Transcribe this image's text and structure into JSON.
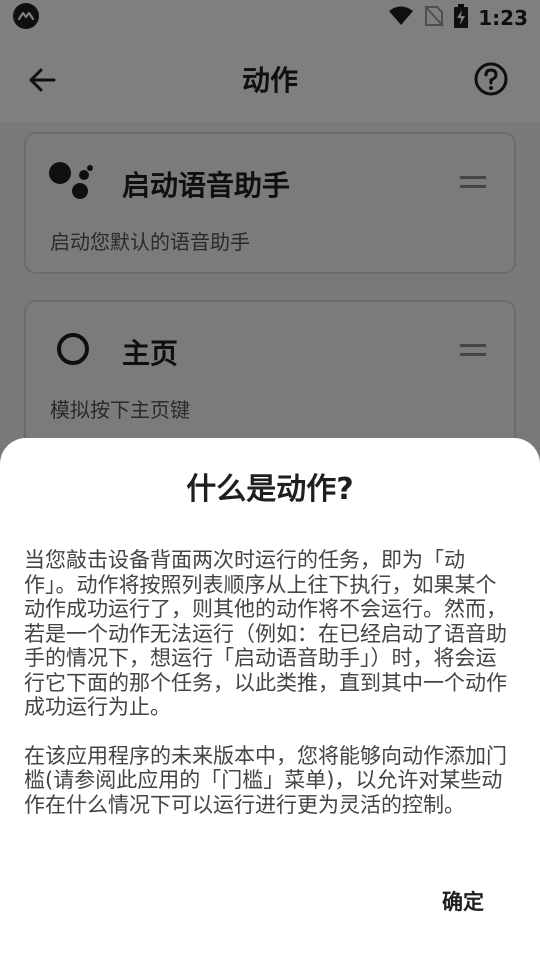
{
  "status_bar": {
    "time": "1:23"
  },
  "app_bar": {
    "title": "动作"
  },
  "cards": [
    {
      "title": "启动语音助手",
      "description": "启动您默认的语音助手"
    },
    {
      "title": "主页",
      "description": "模拟按下主页键"
    }
  ],
  "dialog": {
    "title": "什么是动作?",
    "paragraph_1": "当您敲击设备背面两次时运行的任务，即为「动作」。动作将按照列表顺序从上往下执行，如果某个动作成功运行了，则其他的动作将不会运行。然而，若是一个动作无法运行（例如：在已经启动了语音助手的情况下，想运行「启动语音助手」）时，将会运行它下面的那个任务，以此类推，直到其中一个动作成功运行为止。",
    "paragraph_2": "在该应用程序的未来版本中，您将能够向动作添加门槛(请参阅此应用的「门槛」菜单)，以允许对某些动作在什么情况下可以运行进行更为灵活的控制。",
    "confirm_label": "确定"
  },
  "icons": {
    "status_left": "app-logo-icon",
    "wifi": "wifi-icon",
    "no_signal": "no-sim-icon",
    "battery": "battery-charging-icon",
    "back": "arrow-back-icon",
    "help": "help-circle-icon",
    "assistant": "google-assistant-icon",
    "home": "home-circle-icon",
    "drag": "drag-handle-icon"
  }
}
